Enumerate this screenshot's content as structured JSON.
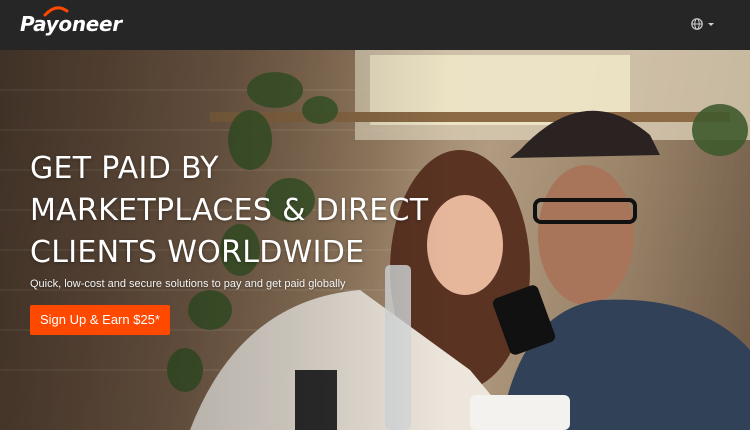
{
  "header": {
    "logo_text": "Payoneer",
    "language_icon": "globe-icon"
  },
  "hero": {
    "headline_lines": [
      "GET PAID BY",
      "MARKETPLACES & DIRECT",
      "CLIENTS WORLDWIDE"
    ],
    "subheadline": "Quick, low-cost and secure solutions to pay and get paid globally",
    "cta_label": "Sign Up & Earn $25*"
  },
  "colors": {
    "header_bg": "#262626",
    "cta": "#ff4800",
    "logo_arc": "#ff4800"
  }
}
